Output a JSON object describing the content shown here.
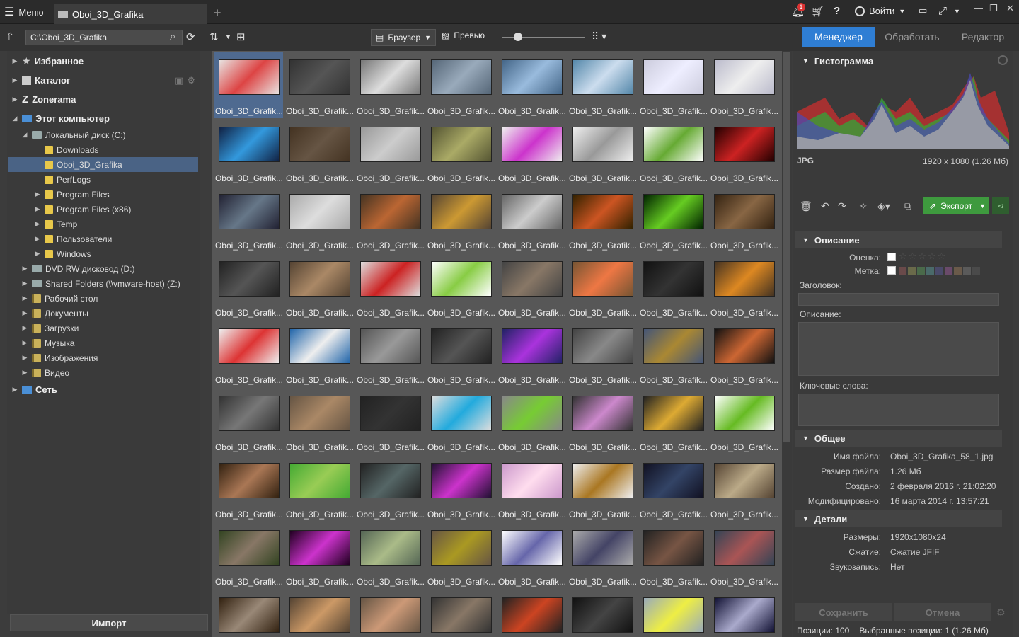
{
  "titlebar": {
    "menu_label": "Меню",
    "tab_label": "Oboi_3D_Grafika",
    "login_label": "Войти",
    "notification_count": "1"
  },
  "toolbar": {
    "path_value": "C:\\Oboi_3D_Grafika",
    "browser_label": "Браузер",
    "preview_label": "Превью",
    "modes": [
      "Менеджер",
      "Обработать",
      "Редактор"
    ]
  },
  "tree": {
    "favorites": "Избранное",
    "catalog": "Каталог",
    "zonerama": "Zonerama",
    "computer": "Этот компьютер",
    "local_disk": "Локальный диск (C:)",
    "folders": [
      "Downloads",
      "Oboi_3D_Grafika",
      "PerfLogs",
      "Program Files",
      "Program Files (x86)",
      "Temp",
      "Пользователи",
      "Windows"
    ],
    "dvd": "DVD RW дисковод (D:)",
    "shared": "Shared Folders (\\\\vmware-host) (Z:)",
    "libs": [
      "Рабочий стол",
      "Документы",
      "Загрузки",
      "Музыка",
      "Изображения",
      "Видео"
    ],
    "network": "Сеть"
  },
  "import_label": "Импорт",
  "grid": {
    "caption": "Oboi_3D_Grafik..."
  },
  "right": {
    "histogram_title": "Гистограмма",
    "format": "JPG",
    "dimensions_size": "1920 x 1080 (1.26 Мб)",
    "export_label": "Экспорт",
    "description_title": "Описание",
    "rating_label": "Оценка:",
    "tag_label": "Метка:",
    "heading_label": "Заголовок:",
    "desc_label": "Описание:",
    "keywords_label": "Ключевые слова:",
    "general_title": "Общее",
    "file_name_label": "Имя файла:",
    "file_name": "Oboi_3D_Grafika_58_1.jpg",
    "file_size_label": "Размер файла:",
    "file_size": "1.26 Мб",
    "created_label": "Создано:",
    "created": "2 февраля 2016 г. 21:02:20",
    "modified_label": "Модифицировано:",
    "modified": "16 марта 2014 г. 13:57:21",
    "details_title": "Детали",
    "size_label": "Размеры:",
    "size": "1920x1080x24",
    "compression_label": "Сжатие:",
    "compression": "Сжатие JFIF",
    "audio_label": "Звукозапись:",
    "audio": "Нет",
    "save_label": "Сохранить",
    "cancel_label": "Отмена"
  },
  "status": {
    "positions": "Позиции: 100",
    "selected": "Выбранные позиции: 1 (1.26 Мб)"
  },
  "colors": {
    "accent": "#2f7ed4",
    "export_green": "#3e9a3e",
    "selection": "#4f6a90"
  }
}
